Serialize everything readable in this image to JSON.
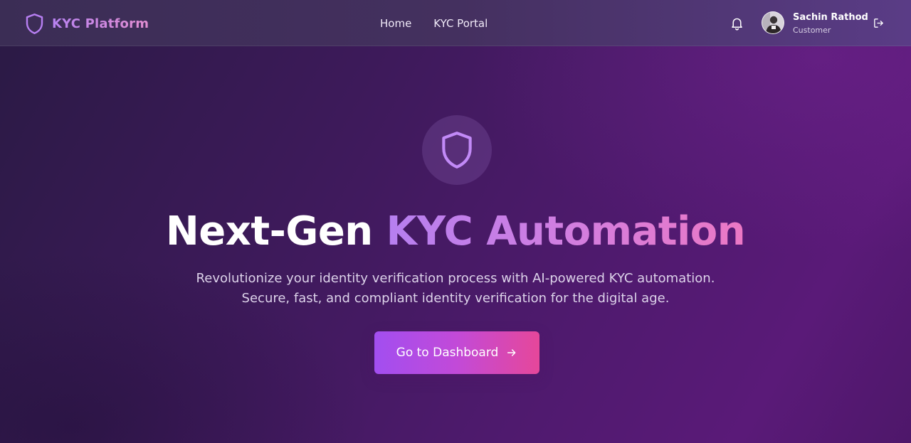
{
  "brand": {
    "name": "KYC Platform",
    "icon": "shield-icon"
  },
  "nav": {
    "items": [
      {
        "label": "Home"
      },
      {
        "label": "KYC Portal"
      }
    ]
  },
  "header": {
    "notifications_icon": "bell-icon",
    "logout_icon": "logout-icon"
  },
  "user": {
    "name": "Sachin Rathod",
    "role": "Customer",
    "avatar_icon": "avatar"
  },
  "hero": {
    "icon": "shield-icon",
    "title_plain": "Next-Gen ",
    "title_accent": "KYC Automation",
    "subtitle_line1": "Revolutionize your identity verification process with AI-powered KYC automation.",
    "subtitle_line2": "Secure, fast, and compliant identity verification for the digital age.",
    "cta_label": "Go to Dashboard",
    "cta_icon": "arrow-right-icon"
  },
  "colors": {
    "accent_purple": "#a855f7",
    "accent_pink": "#ec4899",
    "background_dark": "#2a1a44",
    "background_purple": "#5a1a78"
  }
}
